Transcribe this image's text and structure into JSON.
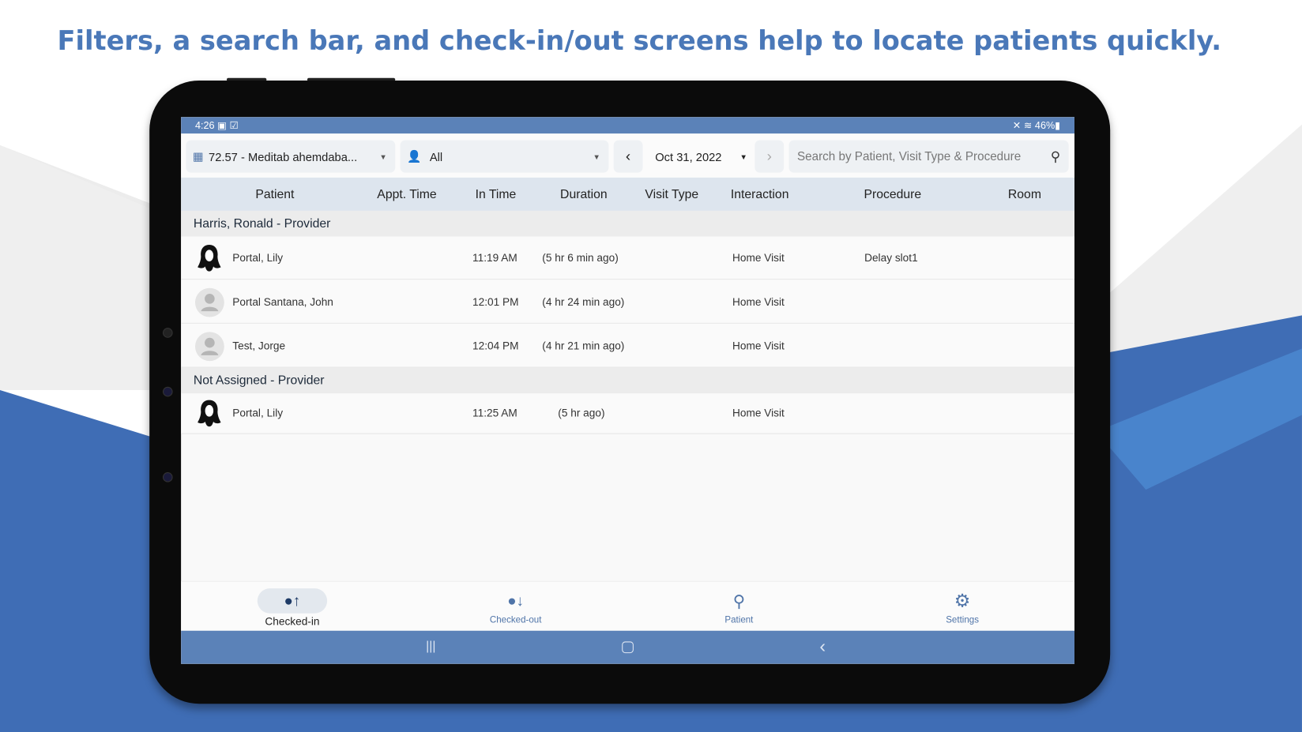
{
  "headline": "Filters, a search bar, and check-in/out screens help to locate patients quickly.",
  "status": {
    "time": "4:26",
    "battery": "46%"
  },
  "toolbar": {
    "facility": "72.57 - Meditab ahemdaba...",
    "provider": "All",
    "date": "Oct 31, 2022",
    "search_placeholder": "Search by Patient, Visit Type & Procedure"
  },
  "columns": [
    "Patient",
    "Appt. Time",
    "In Time",
    "Duration",
    "Visit Type",
    "Interaction",
    "Procedure",
    "Room"
  ],
  "groups": [
    {
      "title": "Harris, Ronald - Provider",
      "rows": [
        {
          "patient": "Portal, Lily",
          "avatar": "female",
          "appt": "",
          "in_time": "11:19 AM",
          "duration": "(5 hr 6 min  ago)",
          "visit_type": "",
          "interaction": "Home Visit",
          "procedure": "Delay slot1",
          "room": ""
        },
        {
          "patient": "Portal Santana, John",
          "avatar": "generic",
          "appt": "",
          "in_time": "12:01 PM",
          "duration": "(4 hr 24 min ago)",
          "visit_type": "",
          "interaction": "Home Visit",
          "procedure": "",
          "room": ""
        },
        {
          "patient": "Test, Jorge",
          "avatar": "generic",
          "appt": "",
          "in_time": "12:04 PM",
          "duration": "(4 hr 21 min ago)",
          "visit_type": "",
          "interaction": "Home Visit",
          "procedure": "",
          "room": ""
        }
      ]
    },
    {
      "title": "Not Assigned - Provider",
      "rows": [
        {
          "patient": "Portal, Lily",
          "avatar": "female",
          "appt": "",
          "in_time": "11:25 AM",
          "duration": "(5 hr  ago)",
          "visit_type": "",
          "interaction": "Home Visit",
          "procedure": "",
          "room": ""
        }
      ]
    }
  ],
  "bottom_nav": [
    {
      "label": "Checked-in",
      "icon": "user-check-in-icon",
      "active": true
    },
    {
      "label": "Checked-out",
      "icon": "user-check-out-icon"
    },
    {
      "label": "Patient",
      "icon": "search-icon"
    },
    {
      "label": "Settings",
      "icon": "gear-icon"
    }
  ],
  "colors": {
    "accent": "#5b82b8",
    "headline": "#4a78b8",
    "background_blue": "#3f6db5"
  }
}
